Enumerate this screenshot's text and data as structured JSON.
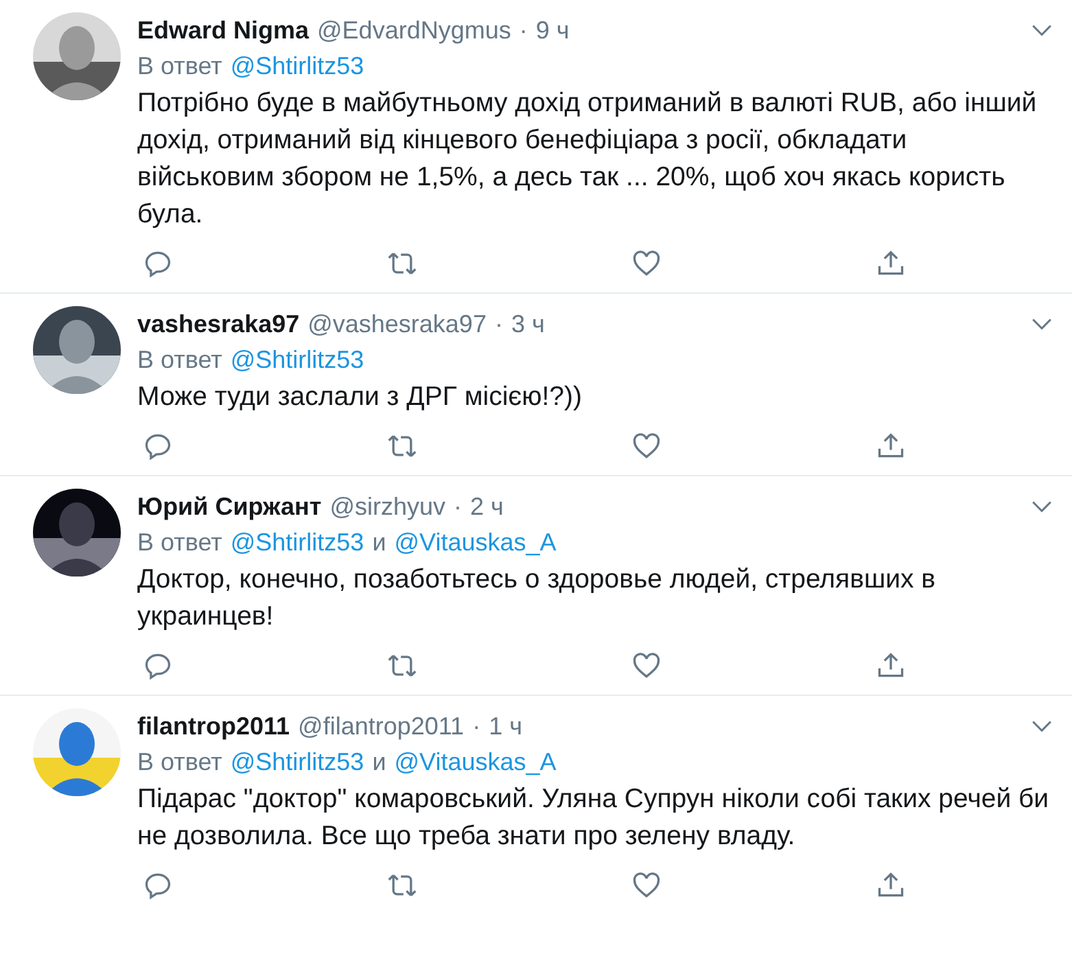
{
  "tweets": [
    {
      "name": "Edward Nigma",
      "handle": "@EdvardNygmus",
      "separator": "·",
      "time": "9 ч",
      "reply_prefix": "В ответ",
      "mentions": [
        "@Shtirlitz53"
      ],
      "text": "Потрібно буде в майбутньому дохід отриманий в валюті RUB, або інший дохід, отриманий від кінцевого бенефіціара з росії, обкладати військовим збором не 1,5%, а десь так ... 20%, щоб хоч якась користь була."
    },
    {
      "name": "vashesraka97",
      "handle": "@vashesraka97",
      "separator": "·",
      "time": "3 ч",
      "reply_prefix": "В ответ",
      "mentions": [
        "@Shtirlitz53"
      ],
      "text": "Може туди заслали з ДРГ місією!?))"
    },
    {
      "name": "Юрий Сиржант",
      "handle": "@sirzhyuv",
      "separator": "·",
      "time": "2 ч",
      "reply_prefix": "В ответ",
      "mentions": [
        "@Shtirlitz53",
        "@Vitauskas_A"
      ],
      "joiner": "и",
      "text": "Доктор, конечно, позаботьтесь о здоровье людей, стрелявших в украинцев!"
    },
    {
      "name": "filantrop2011",
      "handle": "@filantrop2011",
      "separator": "·",
      "time": "1 ч",
      "reply_prefix": "В ответ",
      "mentions": [
        "@Shtirlitz53",
        "@Vitauskas_A"
      ],
      "joiner": "и",
      "text": "Підарас \"доктор\" комаровський. Уляна Супрун ніколи собі таких речей би не дозволила. Все що треба знати про зелену владу."
    }
  ]
}
